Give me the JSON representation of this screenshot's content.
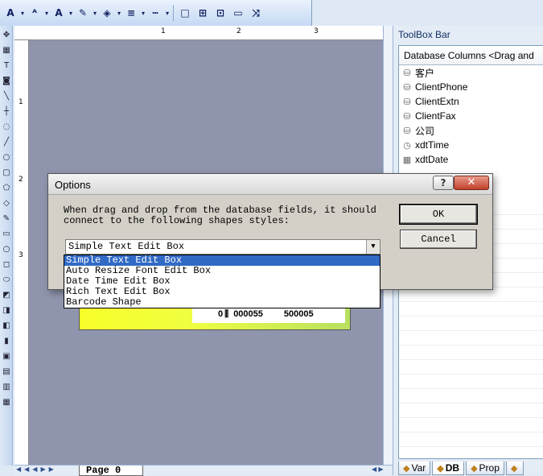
{
  "toolbar": {
    "buttons": [
      {
        "name": "font-size-icon",
        "glyph": "A"
      },
      {
        "name": "font-shrink-icon",
        "glyph": "ᴬ"
      },
      {
        "name": "font-color-icon",
        "glyph": "A"
      },
      {
        "name": "highlight-pen-icon",
        "glyph": "✎"
      },
      {
        "name": "fill-bucket-icon",
        "glyph": "◈"
      },
      {
        "name": "line-weight-icon",
        "glyph": "≡"
      },
      {
        "name": "line-style-icon",
        "glyph": "┅"
      },
      {
        "name": "border-box-icon",
        "glyph": "□"
      },
      {
        "name": "grid-icon",
        "glyph": "⊞"
      },
      {
        "name": "grid-dotted-icon",
        "glyph": "⊡"
      },
      {
        "name": "frame-icon",
        "glyph": "▭"
      },
      {
        "name": "connector-icon",
        "glyph": "⤨"
      }
    ]
  },
  "ruler": {
    "top_labels": [
      "1",
      "2",
      "3"
    ],
    "left_labels": [
      "1",
      "2",
      "3"
    ]
  },
  "canvas": {
    "field_values": [
      "0",
      "000055",
      "500005"
    ]
  },
  "bottom_bar": {
    "page_tab": "Page 0"
  },
  "toolbox": {
    "title": "ToolBox Bar",
    "list_header": "Database Columns <Drag and",
    "items": [
      {
        "label": "客户",
        "icon": "database-icon"
      },
      {
        "label": "ClientPhone",
        "icon": "database-icon"
      },
      {
        "label": "ClientExtn",
        "icon": "database-icon"
      },
      {
        "label": "ClientFax",
        "icon": "database-icon"
      },
      {
        "label": "公司",
        "icon": "database-icon"
      },
      {
        "label": "xdtTime",
        "icon": "clock-icon"
      },
      {
        "label": "xdtDate",
        "icon": "calendar-icon"
      }
    ],
    "tabs": [
      {
        "label": "Var",
        "active": false
      },
      {
        "label": "DB",
        "active": true
      },
      {
        "label": "Prop",
        "active": false
      },
      {
        "label": "",
        "active": false
      }
    ]
  },
  "dialog": {
    "title": "Options",
    "message": "When drag and drop from the database fields, it should\nconnect to the following shapes styles:",
    "ok_label": "OK",
    "cancel_label": "Cancel",
    "help_label": "?",
    "close_label": "✕",
    "combo_value": "Simple Text Edit Box",
    "options": [
      "Simple Text Edit Box",
      "Auto Resize Font Edit Box",
      "Date Time Edit Box",
      "Rich Text Edit Box",
      "Barcode Shape"
    ],
    "selected_index": 0
  }
}
